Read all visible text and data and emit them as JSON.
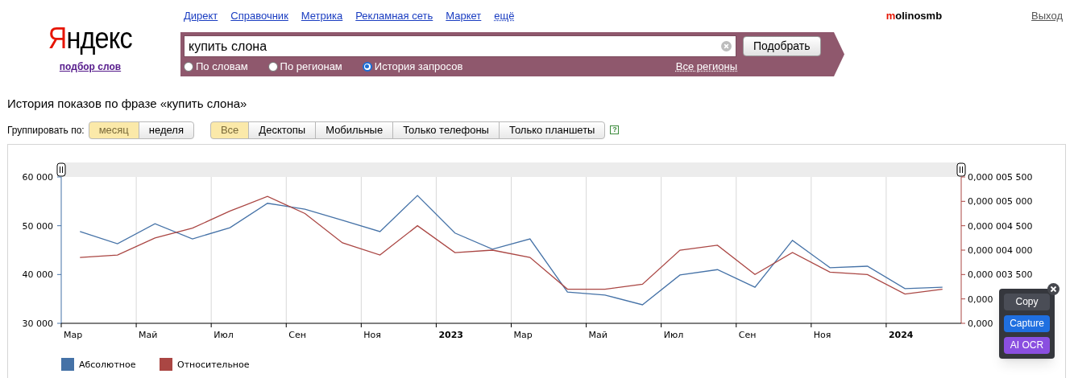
{
  "header": {
    "logo": "Яндекс",
    "logo_caption": "подбор слов",
    "nav_links": [
      {
        "label": "Директ",
        "kind": "link"
      },
      {
        "label": "Справочник",
        "kind": "link"
      },
      {
        "label": "Метрика",
        "kind": "link"
      },
      {
        "label": "Рекламная сеть",
        "kind": "link"
      },
      {
        "label": "Маркет",
        "kind": "link"
      },
      {
        "label": "ещё",
        "kind": "menu"
      }
    ],
    "user": "molinosmb",
    "logout": "Выход"
  },
  "search": {
    "value": "купить слона",
    "button": "Подобрать",
    "modes": [
      {
        "label": "По словам",
        "selected": false
      },
      {
        "label": "По регионам",
        "selected": false
      },
      {
        "label": "История запросов",
        "selected": true
      }
    ],
    "regions_link": "Все регионы"
  },
  "title": "История показов по фразе «купить слона»",
  "grouping": {
    "label": "Группировать по:",
    "options": [
      {
        "label": "месяц",
        "selected": true
      },
      {
        "label": "неделя",
        "selected": false
      }
    ]
  },
  "devices": [
    {
      "label": "Все",
      "selected": true
    },
    {
      "label": "Десктопы",
      "selected": false
    },
    {
      "label": "Мобильные",
      "selected": false
    },
    {
      "label": "Только телефоны",
      "selected": false
    },
    {
      "label": "Только планшеты",
      "selected": false
    }
  ],
  "help": "?",
  "chart": {
    "chart_data": {
      "type": "line",
      "categories": [
        "Мар",
        null,
        "Май",
        null,
        "Июл",
        null,
        "Сен",
        null,
        "Ноя",
        null,
        "2023",
        null,
        "Мар",
        null,
        "Май",
        null,
        "Июл",
        null,
        "Сен",
        null,
        "Ноя",
        null,
        "2024",
        null
      ],
      "ylim": [
        30000,
        60000
      ],
      "yticks": [
        {
          "value": 30000,
          "label": "30 000"
        },
        {
          "value": 40000,
          "label": "40 000"
        },
        {
          "value": 50000,
          "label": "50 000"
        },
        {
          "value": 60000,
          "label": "60 000"
        }
      ],
      "legend": true,
      "y2lim": [
        2.5e-06,
        5.5e-06
      ],
      "y2ticks": [
        {
          "value": 5.5e-06,
          "label": "0,000 005 500"
        },
        {
          "value": 5e-06,
          "label": "0,000 005 000"
        },
        {
          "value": 4.5e-06,
          "label": "0,000 004 500"
        },
        {
          "value": 4e-06,
          "label": "0,000 004 000"
        },
        {
          "value": 3.5e-06,
          "label": "0,000 003 500"
        },
        {
          "value": 3e-06,
          "label": "0,000"
        },
        {
          "value": 2.5e-06,
          "label": "0,000"
        }
      ],
      "series": [
        {
          "name": "Абсолютное",
          "color": "#4572a7",
          "values": [
            48800,
            46300,
            50400,
            47300,
            49600,
            54600,
            53400,
            51100,
            48800,
            56200,
            48500,
            45200,
            47300,
            36400,
            35800,
            33800,
            39900,
            41000,
            37400,
            47000,
            41400,
            41700,
            37100,
            37400
          ]
        },
        {
          "name": "Относительное",
          "color": "#aa4643",
          "axis": "y2",
          "values": [
            3.85e-06,
            3.9e-06,
            4.25e-06,
            4.45e-06,
            4.8e-06,
            5.1e-06,
            4.75e-06,
            4.15e-06,
            3.9e-06,
            4.5e-06,
            3.95e-06,
            4e-06,
            3.85e-06,
            3.2e-06,
            3.2e-06,
            3.3e-06,
            4e-06,
            4.1e-06,
            3.5e-06,
            3.95e-06,
            3.55e-06,
            3.5e-06,
            3.1e-06,
            3.2e-06
          ]
        }
      ]
    }
  },
  "popup": {
    "buttons": [
      {
        "label": "Copy",
        "kind": "copy"
      },
      {
        "label": "Capture",
        "kind": "capture"
      },
      {
        "label": "AI OCR",
        "kind": "ocr"
      }
    ]
  }
}
